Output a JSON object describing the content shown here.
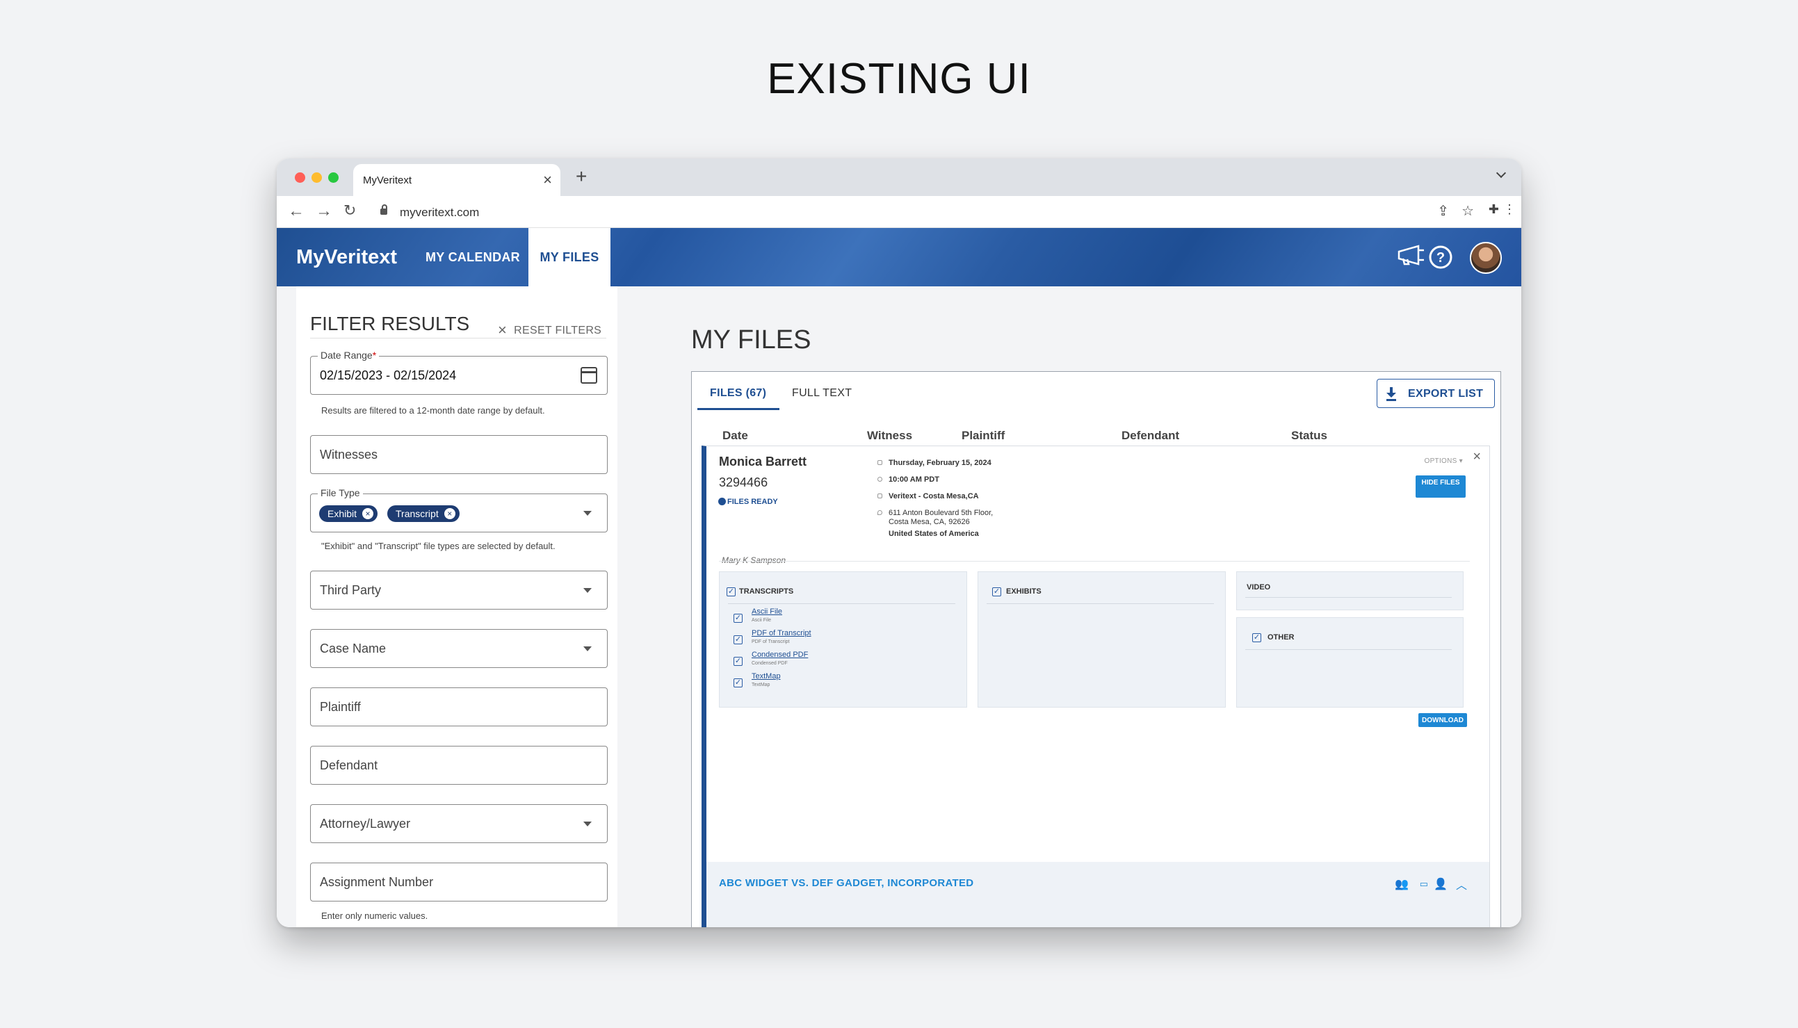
{
  "page": {
    "heading": "EXISTING UI"
  },
  "browser": {
    "tab_title": "MyVeritext",
    "url": "myveritext.com",
    "colors": {
      "close": "#ff5f57",
      "minimize": "#febc2e",
      "zoom": "#28c840"
    }
  },
  "app": {
    "brand": "MyVeritext",
    "nav": [
      "MY CALENDAR",
      "MY FILES"
    ],
    "active_nav": "MY FILES",
    "accent": "#1f4f92",
    "link_blue": "#1e88d4"
  },
  "filters": {
    "title": "FILTER RESULTS",
    "reset": "RESET FILTERS",
    "date_range": {
      "label": "Date Range",
      "required_mark": "*",
      "value": "02/15/2023 - 02/15/2024",
      "help": "Results are filtered to a 12-month date range by default."
    },
    "witnesses": {
      "placeholder": "Witnesses"
    },
    "file_type": {
      "label": "File Type",
      "chips": [
        "Exhibit",
        "Transcript"
      ],
      "help": "\"Exhibit\" and \"Transcript\" file types are selected by default."
    },
    "third_party": {
      "placeholder": "Third Party"
    },
    "case_name": {
      "placeholder": "Case Name"
    },
    "plaintiff": {
      "placeholder": "Plaintiff"
    },
    "defendant": {
      "placeholder": "Defendant"
    },
    "attorney": {
      "placeholder": "Attorney/Lawyer"
    },
    "assignment": {
      "placeholder": "Assignment Number",
      "help": "Enter only numeric values."
    }
  },
  "main": {
    "title": "MY FILES",
    "tabs": [
      "FILES (67)",
      "FULL TEXT"
    ],
    "export": "EXPORT LIST",
    "columns": [
      "Date",
      "Witness",
      "Plaintiff",
      "Defendant",
      "Status"
    ],
    "record": {
      "name": "Monica Barrett",
      "number": "3294466",
      "status": "FILES READY",
      "date": "Thursday, February 15, 2024",
      "time": "10:00 AM PDT",
      "location": "Veritext - Costa Mesa,CA",
      "address1": "611 Anton Boulevard 5th Floor,",
      "address2": "Costa Mesa, CA, 92626",
      "country": "United States of America",
      "options": "OPTIONS ▾",
      "hide_files": "HIDE FILES",
      "witness": "Mary K Sampson",
      "transcripts": {
        "title": "TRANSCRIPTS",
        "files": [
          {
            "name": "Ascii File",
            "sub": "Ascii File"
          },
          {
            "name": "PDF of Transcript",
            "sub": "PDF of Transcript"
          },
          {
            "name": "Condensed PDF",
            "sub": "Condensed PDF"
          },
          {
            "name": "TextMap",
            "sub": "TextMap"
          }
        ]
      },
      "exhibits": "EXHIBITS",
      "video": "VIDEO",
      "other": "OTHER",
      "download": "DOWNLOAD",
      "case": "ABC WIDGET VS. DEF GADGET, INCORPORATED"
    }
  }
}
